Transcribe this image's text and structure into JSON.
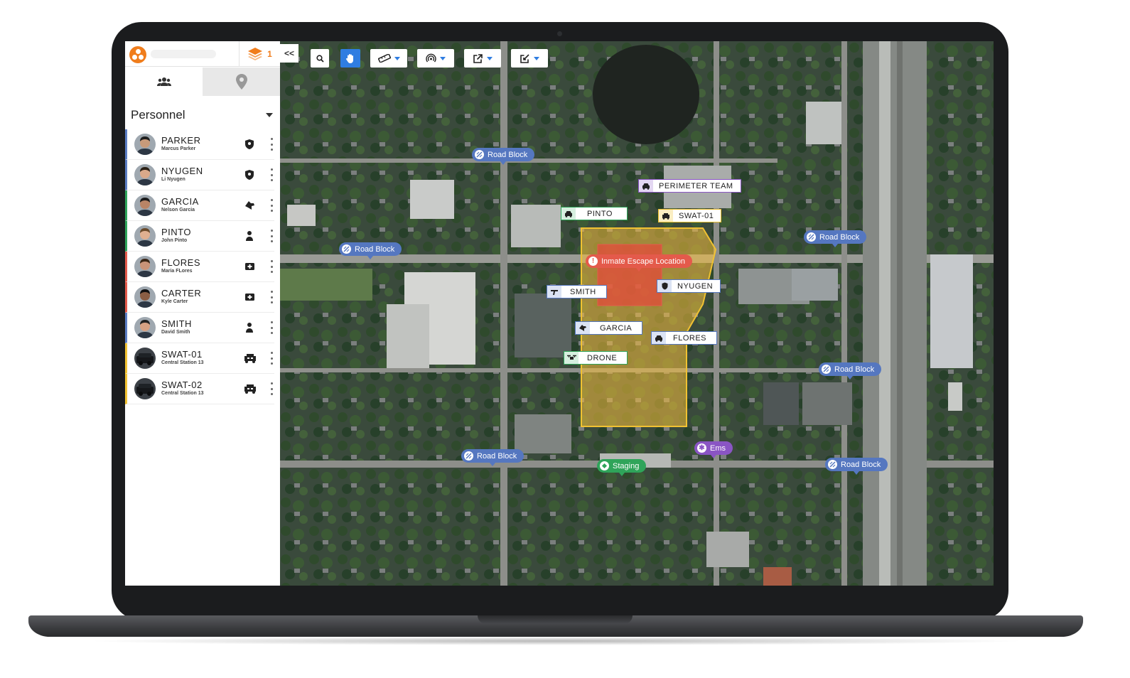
{
  "sidebar": {
    "layer_count": "1",
    "collapse_label": "<<",
    "personnel_title": "Personnel",
    "personnel": [
      {
        "name": "PARKER",
        "sub": "Marcus Parker",
        "type_icon": "police-badge-icon",
        "color": "#5b7dc4"
      },
      {
        "name": "NYUGEN",
        "sub": "Li Nyugen",
        "type_icon": "police-badge-icon",
        "color": "#5b7dc4"
      },
      {
        "name": "GARCIA",
        "sub": "Nelson Garcia",
        "type_icon": "k9-dog-icon",
        "color": "#2fa45a"
      },
      {
        "name": "PINTO",
        "sub": "John Pinto",
        "type_icon": "person-icon",
        "color": "#2fa45a"
      },
      {
        "name": "FLORES",
        "sub": "Maria FLores",
        "type_icon": "ambulance-icon",
        "color": "#e45a4b"
      },
      {
        "name": "CARTER",
        "sub": "Kyle Carter",
        "type_icon": "ambulance-icon",
        "color": "#e45a4b"
      },
      {
        "name": "SMITH",
        "sub": "David Smith",
        "type_icon": "person-icon",
        "color": "#5b7dc4"
      },
      {
        "name": "SWAT-01",
        "sub": "Central Station 13",
        "type_icon": "swat-vehicle-icon",
        "color": "#f1c232"
      },
      {
        "name": "SWAT-02",
        "sub": "Central Station 13",
        "type_icon": "swat-vehicle-icon",
        "color": "#f1c232"
      }
    ]
  },
  "map": {
    "markers": [
      {
        "label": "Road Block",
        "kind": "blue"
      },
      {
        "label": "Road Block",
        "kind": "blue"
      },
      {
        "label": "Road Block",
        "kind": "blue"
      },
      {
        "label": "Road Block",
        "kind": "blue"
      },
      {
        "label": "Road Block",
        "kind": "blue"
      },
      {
        "label": "Road Block",
        "kind": "blue"
      },
      {
        "label": "Inmate Escape Location",
        "kind": "red"
      },
      {
        "label": "Staging",
        "kind": "green"
      },
      {
        "label": "Ems",
        "kind": "purple"
      }
    ],
    "units": [
      {
        "label": "PERIMETER TEAM",
        "icon": "police-car-icon",
        "color": "#8a55c4"
      },
      {
        "label": "PINTO",
        "icon": "police-car-icon",
        "color": "#2fa45a"
      },
      {
        "label": "SWAT-01",
        "icon": "swat-vehicle-icon",
        "color": "#f1c232"
      },
      {
        "label": "SMITH",
        "icon": "gun-icon",
        "color": "#5577c0"
      },
      {
        "label": "NYUGEN",
        "icon": "police-badge-icon",
        "color": "#5577c0"
      },
      {
        "label": "GARCIA",
        "icon": "k9-dog-icon",
        "color": "#5577c0"
      },
      {
        "label": "FLORES",
        "icon": "police-car-icon",
        "color": "#5577c0"
      },
      {
        "label": "DRONE",
        "icon": "drone-icon",
        "color": "#2fa45a"
      }
    ]
  }
}
